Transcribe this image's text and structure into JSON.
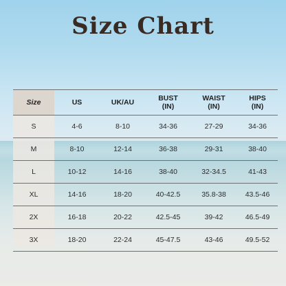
{
  "title": "Size Chart",
  "table": {
    "headers": [
      {
        "line1": "Size",
        "line2": ""
      },
      {
        "line1": "US",
        "line2": ""
      },
      {
        "line1": "UK/AU",
        "line2": ""
      },
      {
        "line1": "BUST",
        "line2": "(IN)"
      },
      {
        "line1": "WAIST",
        "line2": "(IN)"
      },
      {
        "line1": "HIPS",
        "line2": "(IN)"
      }
    ],
    "rows": [
      [
        "S",
        "4-6",
        "8-10",
        "34-36",
        "27-29",
        "34-36"
      ],
      [
        "M",
        "8-10",
        "12-14",
        "36-38",
        "29-31",
        "38-40"
      ],
      [
        "L",
        "10-12",
        "14-16",
        "38-40",
        "32-34.5",
        "41-43"
      ],
      [
        "XL",
        "14-16",
        "18-20",
        "40-42.5",
        "35.8-38",
        "43.5-46"
      ],
      [
        "2X",
        "16-18",
        "20-22",
        "42.5-45",
        "39-42",
        "46.5-49"
      ],
      [
        "3X",
        "18-20",
        "22-24",
        "45-47.5",
        "43-46",
        "49.5-52"
      ]
    ]
  }
}
